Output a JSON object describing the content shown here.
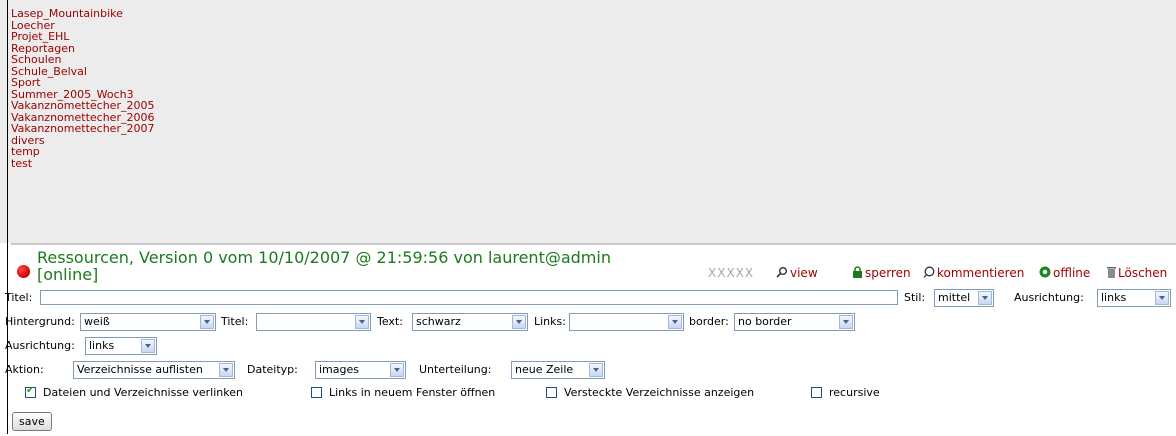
{
  "folders": [
    "Lasep_Mountainbike",
    "Loecher",
    "Projet_EHL",
    "Reportagen",
    "Schoulen",
    "Schule_Belval",
    "Sport",
    "Summer_2005_Woch3",
    "Vakanznomettecher_2005",
    "Vakanznomettecher_2006",
    "Vakanznomettecher_2007",
    "divers",
    "temp",
    "test"
  ],
  "resource": {
    "title_line1": "Ressourcen, Version 0 vom 10/10/2007 @ 21:59:56 von laurent@admin",
    "title_line2": "[online]",
    "status_color": "#cc0000",
    "title_color": "#1d7a1d"
  },
  "toolbar": {
    "stars": "XXXXX",
    "view": "view",
    "sperren": "sperren",
    "kommentieren": "kommentieren",
    "offline": "offline",
    "loeschen": "Löschen"
  },
  "form": {
    "titel_label": "Titel:",
    "titel_value": "",
    "stil_label": "Stil:",
    "stil_value": "mittel",
    "ausrichtung_label": "Ausrichtung:",
    "ausrichtung_value": "links",
    "hintergrund_label": "Hintergrund:",
    "hintergrund_value": "weiß",
    "titel_color_label": "Titel:",
    "titel_color_value": "",
    "text_label": "Text:",
    "text_value": "schwarz",
    "links_label": "Links:",
    "links_value": "",
    "border_label": "border:",
    "border_value": "no border",
    "ausrichtung2_label": "Ausrichtung:",
    "ausrichtung2_value": "links",
    "aktion_label": "Aktion:",
    "aktion_value": "Verzeichnisse auflisten",
    "dateityp_label": "Dateityp:",
    "dateityp_value": "images",
    "unterteilung_label": "Unterteilung:",
    "unterteilung_value": "neue Zeile"
  },
  "checkboxes": [
    {
      "label": "Dateien und Verzeichnisse verlinken",
      "checked": true
    },
    {
      "label": "Links in neuem Fenster öffnen",
      "checked": false
    },
    {
      "label": "Versteckte Verzeichnisse anzeigen",
      "checked": false
    },
    {
      "label": "recursive",
      "checked": false
    }
  ],
  "save_label": "save",
  "colors": {
    "link": "#990000",
    "panel_bg": "#ececec",
    "green": "#1d7a1d"
  }
}
